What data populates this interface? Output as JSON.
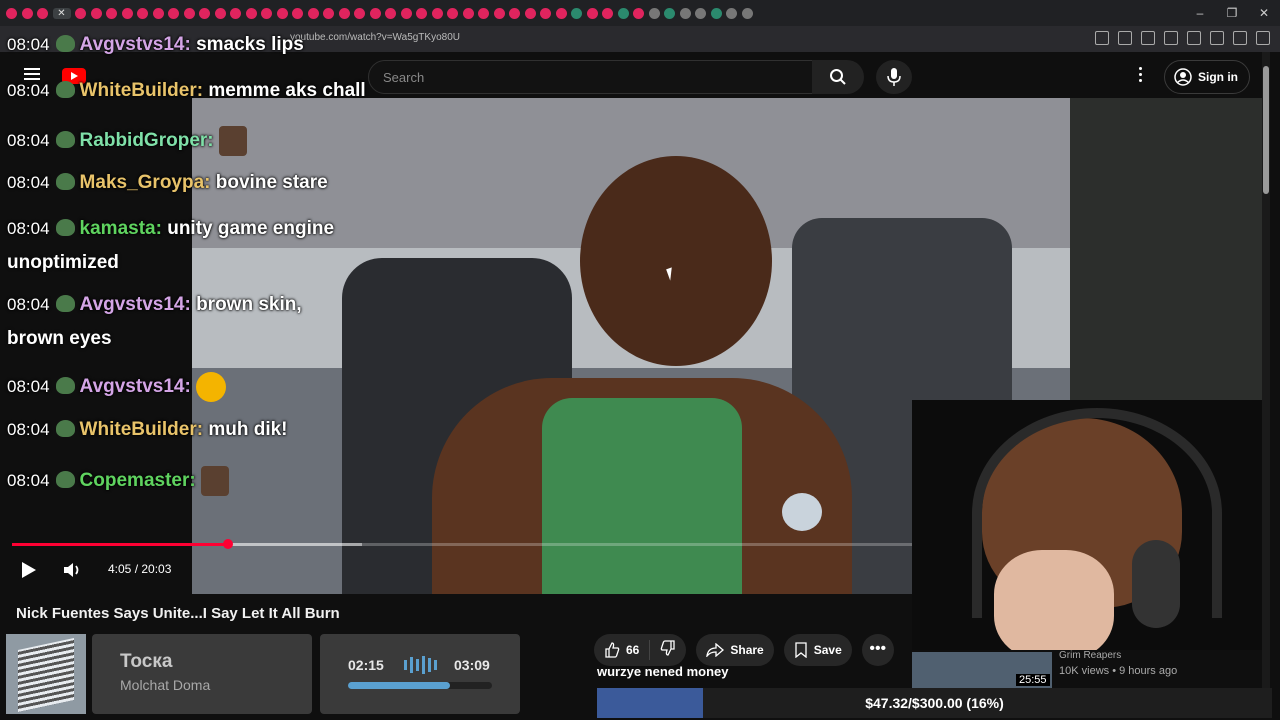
{
  "browser": {
    "url": "youtube.com/watch?v=Wa5gTKyo80U",
    "window_controls": [
      "–",
      "❐",
      "✕"
    ]
  },
  "youtube": {
    "search_placeholder": "Search",
    "sign_in_label": "Sign in"
  },
  "chat": {
    "messages": [
      {
        "time": "08:04",
        "user": "Avgvstvs14",
        "user_color": "#d4a5e6",
        "text": "smacks lips"
      },
      {
        "time": "08:04",
        "user": "WhiteBuilder",
        "user_color": "#e8c36a",
        "text": "memme aks chall"
      },
      {
        "time": "08:04",
        "user": "RabbidGroper",
        "user_color": "#7fe0a8",
        "text": ""
      },
      {
        "time": "08:04",
        "user": "Maks_Groypa",
        "user_color": "#e8c36a",
        "text": "bovine stare"
      },
      {
        "time": "08:04",
        "user": "kamasta",
        "user_color": "#5fd35f",
        "text": "unity game engine",
        "text_cont": "unoptimized"
      },
      {
        "time": "08:04",
        "user": "Avgvstvs14",
        "user_color": "#d4a5e6",
        "text": "brown skin,",
        "text_cont": "brown eyes"
      },
      {
        "time": "08:04",
        "user": "Avgvstvs14",
        "user_color": "#d4a5e6",
        "text": ""
      },
      {
        "time": "08:04",
        "user": "WhiteBuilder",
        "user_color": "#e8c36a",
        "text": "muh dik!"
      },
      {
        "time": "08:04",
        "user": "Copemaster",
        "user_color": "#5fd35f",
        "text": ""
      }
    ]
  },
  "player": {
    "time_display": "4:05 / 20:03",
    "progress_fraction": 0.204
  },
  "video": {
    "title": "Nick Fuentes Says Unite...I Say Let It All Burn",
    "likes": "66",
    "share_label": "Share",
    "save_label": "Save"
  },
  "now_playing": {
    "track": "Тоска",
    "artist": "Molchat Doma",
    "current": "02:15",
    "total": "03:09",
    "progress_fraction": 0.71
  },
  "donation": {
    "message": "wurzye nened money",
    "goal_text": "$47.32/$300.00 (16%)",
    "goal_fraction": 0.16
  },
  "recommendation": {
    "channel": "Grim Reapers",
    "meta": "10K views • 9 hours ago",
    "duration": "25:55"
  },
  "colors": {
    "accent": "#ff0033",
    "goal": "#3b5a9a"
  }
}
